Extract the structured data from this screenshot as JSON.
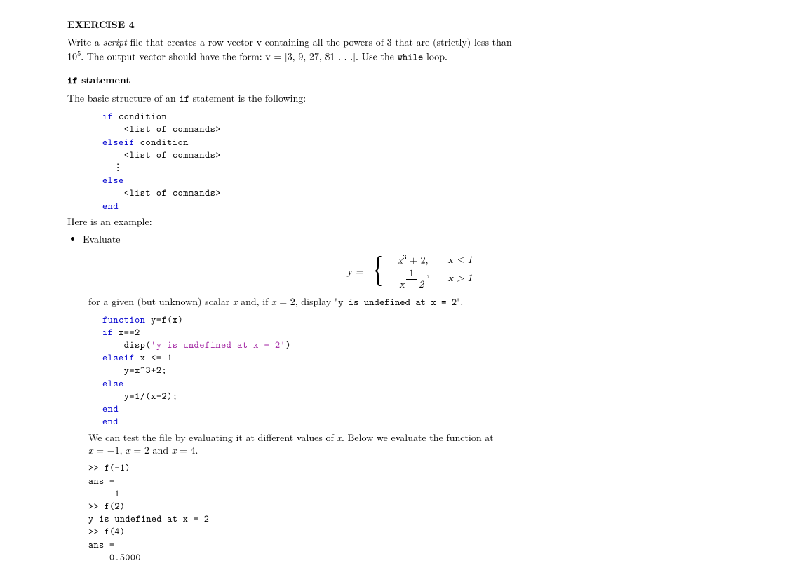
{
  "exercise": {
    "heading": "EXERCISE 4",
    "l1a": "Write a ",
    "l1b": "script",
    "l1c": " file that creates a row vector v containing all the powers of 3 that are (strictly) less than",
    "l2a": "10",
    "l2b": "5",
    "l2c": ". The output vector should have the form: v = [3, 9, 27, 81 . . .]. Use the ",
    "l2d": "while",
    "l2e": " loop."
  },
  "ifsect": {
    "heading_a": "if",
    "heading_b": " statement",
    "intro_a": "The basic structure of an ",
    "intro_b": "if",
    "intro_c": " statement is the following:"
  },
  "codeA": {
    "l1": "if",
    "l1b": " condition",
    "l2": "    <list of commands>",
    "l3": "elseif",
    "l3b": " condition",
    "l4": "    <list of commands>",
    "dots": "  ⋮",
    "l5": "else",
    "l6": "    <list of commands>",
    "l7": "end"
  },
  "example_intro": "Here is an example:",
  "bullet": "Evaluate",
  "eq": {
    "lhs": "y =",
    "row1_expr_a": "x",
    "row1_expr_b": "3",
    "row1_expr_c": " + 2,",
    "row1_cond": "x ≤ 1",
    "row2_num": "1",
    "row2_den": "x − 2",
    "row2_comma": ",",
    "row2_cond": "x > 1"
  },
  "given": {
    "a": "for a given (but unknown) scalar ",
    "x": "x",
    "b": " and, if ",
    "c": " = 2, display \"",
    "d": "y is undefined at x = 2",
    "e": "\"."
  },
  "codeB": {
    "l1": "function",
    "l1b": " y=f(x)",
    "l2": "if",
    "l2b": " x==2",
    "l3a": "    disp(",
    "l3b": "'y is undefined at x = 2'",
    "l3c": ")",
    "l4": "elseif",
    "l4b": " x <= 1",
    "l5": "    y=x^3+2;",
    "l6": "else",
    "l7": "    y=1/(x-2);",
    "l8": "end",
    "l9": "end"
  },
  "test_para": {
    "a": "We can test the file by evaluating it at different values of ",
    "x": "x",
    "b": ".  Below we evaluate the function at",
    "c": "x",
    "d": " = −1, ",
    "e": "x",
    "f": " = 2 and ",
    "g": "x",
    "h": " = 4."
  },
  "codeC": {
    "l1": ">> f(-1)",
    "l2": "ans =",
    "l3": "     1",
    "l4": ">> f(2)",
    "l5": "y is undefined at x = 2",
    "l6": ">> f(4)",
    "l7": "ans =",
    "l8": "    0.5000"
  }
}
